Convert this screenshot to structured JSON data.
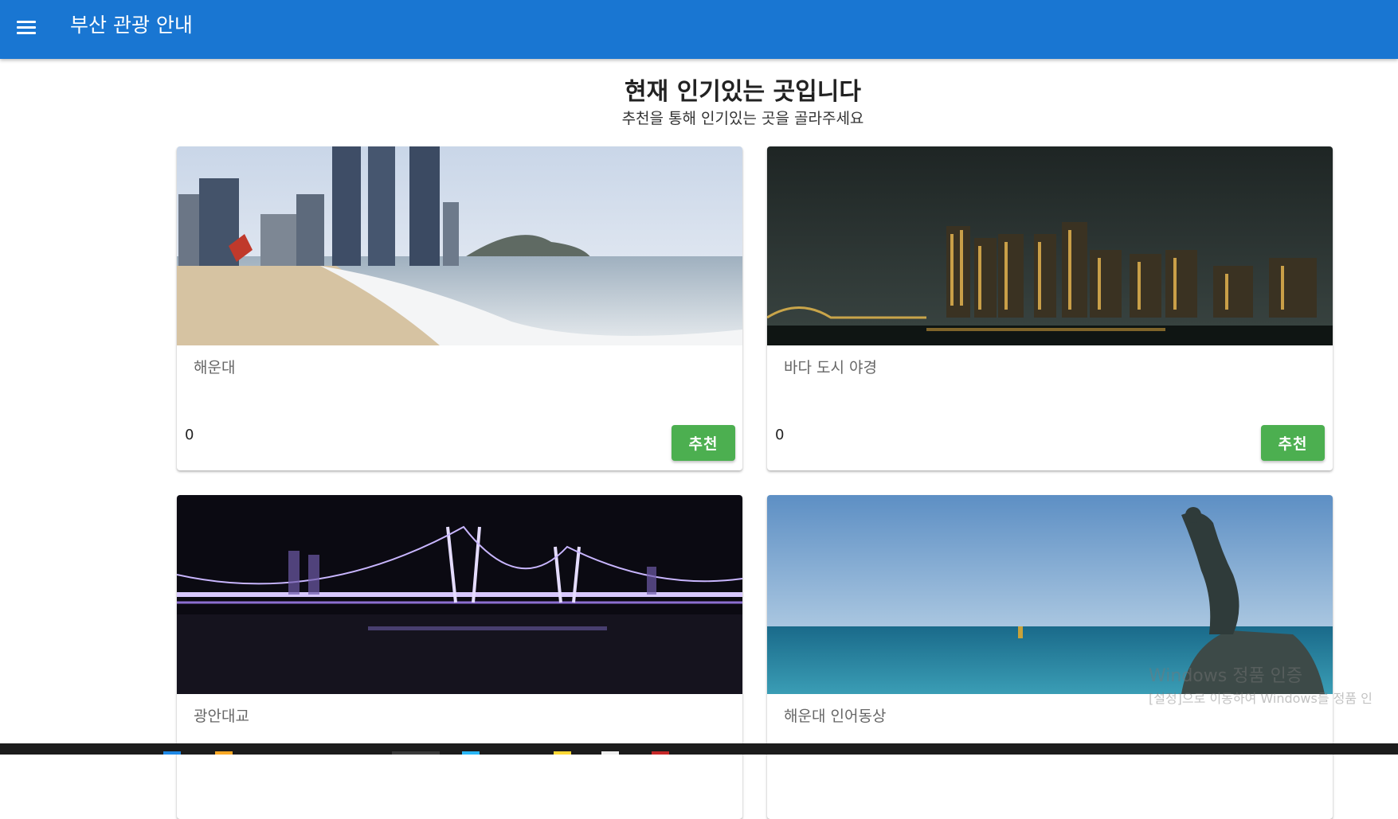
{
  "app": {
    "title": "부산 관광 안내"
  },
  "main": {
    "heading": "현재 인기있는 곳입니다",
    "subheading": "추천을 통해 인기있는 곳을 골라주세요"
  },
  "cards": [
    {
      "title": "해운대",
      "count": "0",
      "button_label": "추천",
      "image": "haeundae-beach-photo"
    },
    {
      "title": "바다 도시 야경",
      "count": "0",
      "button_label": "추천",
      "image": "city-night-skyline-photo"
    },
    {
      "title": "광안대교",
      "image": "gwangan-bridge-night-photo"
    },
    {
      "title": "해운대 인어동상",
      "image": "mermaid-statue-sea-photo"
    }
  ],
  "os": {
    "activation_title": "Windows 정품 인증",
    "activation_subtitle": "[설정]으로 이동하여 Windows를 정품 인"
  },
  "colors": {
    "appbar": "#1976d2",
    "button": "#4caf50"
  }
}
